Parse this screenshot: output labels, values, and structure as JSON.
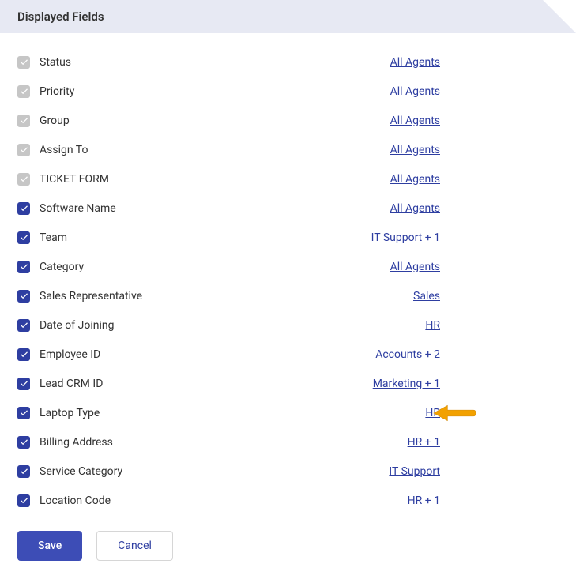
{
  "header": {
    "title": "Displayed Fields"
  },
  "fields": [
    {
      "label": "Status",
      "scope": "All Agents",
      "locked": true,
      "arrow": false
    },
    {
      "label": "Priority",
      "scope": "All Agents",
      "locked": true,
      "arrow": false
    },
    {
      "label": "Group",
      "scope": "All Agents",
      "locked": true,
      "arrow": false
    },
    {
      "label": "Assign To",
      "scope": "All Agents",
      "locked": true,
      "arrow": false
    },
    {
      "label": "TICKET FORM",
      "scope": "All Agents",
      "locked": true,
      "arrow": false
    },
    {
      "label": "Software Name",
      "scope": "All Agents",
      "locked": false,
      "arrow": false
    },
    {
      "label": "Team",
      "scope": "IT Support + 1",
      "locked": false,
      "arrow": false
    },
    {
      "label": "Category",
      "scope": "All Agents",
      "locked": false,
      "arrow": false
    },
    {
      "label": "Sales Representative",
      "scope": "Sales",
      "locked": false,
      "arrow": false
    },
    {
      "label": "Date of Joining",
      "scope": "HR",
      "locked": false,
      "arrow": false
    },
    {
      "label": "Employee ID",
      "scope": "Accounts + 2",
      "locked": false,
      "arrow": false
    },
    {
      "label": "Lead CRM ID",
      "scope": "Marketing + 1",
      "locked": false,
      "arrow": false
    },
    {
      "label": "Laptop Type",
      "scope": "HR",
      "locked": false,
      "arrow": true
    },
    {
      "label": "Billing Address",
      "scope": "HR + 1",
      "locked": false,
      "arrow": false
    },
    {
      "label": "Service Category",
      "scope": "IT Support",
      "locked": false,
      "arrow": false
    },
    {
      "label": "Location Code",
      "scope": "HR + 1",
      "locked": false,
      "arrow": false
    }
  ],
  "buttons": {
    "save": "Save",
    "cancel": "Cancel"
  },
  "colors": {
    "accent": "#2e3ea1",
    "locked_checkbox": "#c6c6c6",
    "header_bg": "#e7e9f3",
    "arrow": "#f2a100"
  }
}
